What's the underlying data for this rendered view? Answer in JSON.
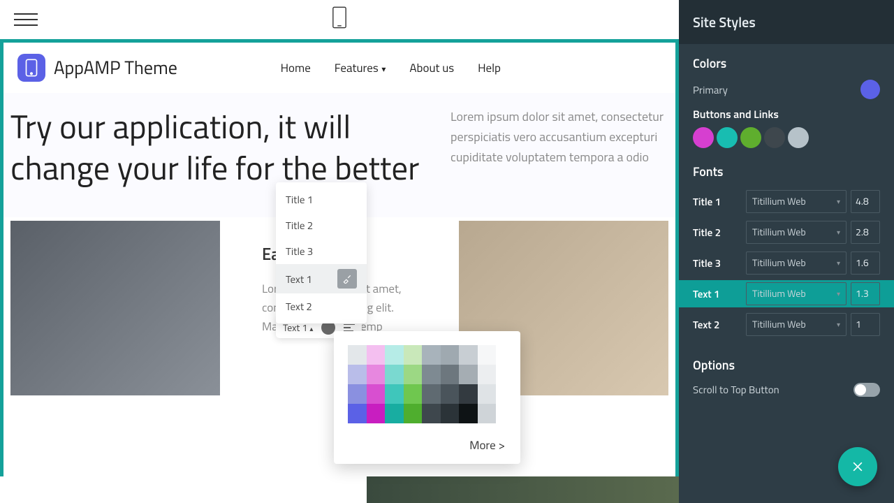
{
  "topbar": {
    "device": "mobile"
  },
  "site": {
    "brand": "AppAMP Theme",
    "nav": {
      "home": "Home",
      "features": "Features",
      "about": "About us",
      "help": "Help"
    },
    "hero": {
      "title": "Try our application, it will change your life for the better",
      "text": "Lorem ipsum dolor sit amet, consectetur perspiciatis vero accusantium excepturi cupiditate voluptatem tempora a odio"
    },
    "card": {
      "title": "Easy",
      "text": "Lorem ipsum dolor sit amet, consectetur adipiscing elit. Mauris malesuada temp"
    }
  },
  "style_dropdown": {
    "items": [
      "Title 1",
      "Title 2",
      "Title 3",
      "Text 1",
      "Text 2"
    ],
    "active": "Text 1"
  },
  "inline_toolbar": {
    "label": "Text 1"
  },
  "palette": {
    "more": "More >",
    "colors": [
      "#e3e7ea",
      "#f4bff0",
      "#b6ece7",
      "#c9e8ba",
      "#a8b3bb",
      "#9fa9b0",
      "#c8ced3",
      "#f6f7f8",
      "#b9bde9",
      "#e787df",
      "#7ad9d0",
      "#9cd884",
      "#7e8a92",
      "#6d777e",
      "#a5adb3",
      "#eceef0",
      "#8a90e0",
      "#d84fd0",
      "#3fc6bb",
      "#6fc74f",
      "#5f6a71",
      "#4a545b",
      "#333a40",
      "#dfe3e6",
      "#5b61e6",
      "#c81ec0",
      "#18ada1",
      "#4fae2e",
      "#3e474d",
      "#2b3338",
      "#0e1315",
      "#cfd4d8"
    ]
  },
  "sidebar": {
    "title": "Site Styles",
    "colors_heading": "Colors",
    "primary_label": "Primary",
    "primary_color": "#5b61e6",
    "buttons_label": "Buttons and Links",
    "button_colors": [
      "#d63fd0",
      "#18bdb1",
      "#5fae2e",
      "#3e474d",
      "#b6c2c9"
    ],
    "fonts_heading": "Fonts",
    "fonts": [
      {
        "label": "Title 1",
        "family": "Titillium Web",
        "size": "4.8"
      },
      {
        "label": "Title 2",
        "family": "Titillium Web",
        "size": "2.8"
      },
      {
        "label": "Title 3",
        "family": "Titillium Web",
        "size": "1.6"
      },
      {
        "label": "Text 1",
        "family": "Titillium Web",
        "size": "1.3",
        "active": true
      },
      {
        "label": "Text 2",
        "family": "Titillium Web",
        "size": "1"
      }
    ],
    "options_heading": "Options",
    "scroll_top_label": "Scroll to Top Button",
    "scroll_top_on": false
  }
}
